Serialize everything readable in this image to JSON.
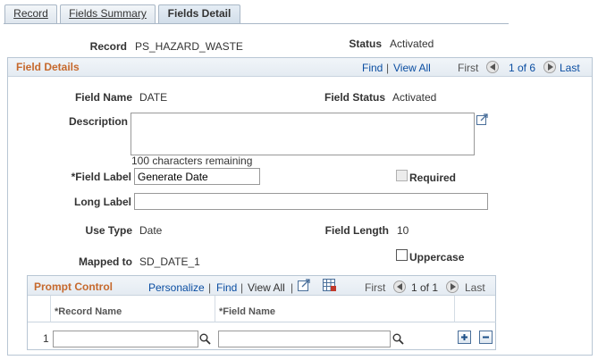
{
  "tabs": [
    {
      "label": "Record",
      "active": false
    },
    {
      "label": "Fields Summary",
      "active": false
    },
    {
      "label": "Fields Detail",
      "active": true
    }
  ],
  "header": {
    "record_label": "Record",
    "record_value": "PS_HAZARD_WASTE",
    "status_label": "Status",
    "status_value": "Activated"
  },
  "section": {
    "title": "Field Details",
    "find": "Find",
    "sep": "|",
    "view_all": "View All",
    "first": "First",
    "count": "1 of 6",
    "last": "Last"
  },
  "fields": {
    "field_name_label": "Field Name",
    "field_name_value": "DATE",
    "field_status_label": "Field Status",
    "field_status_value": "Activated",
    "description_label": "Description",
    "description_value": "",
    "chars_remaining": "100 characters remaining",
    "field_label_label": "*Field Label",
    "field_label_value": "Generate Date",
    "required_label": "Required",
    "long_label_label": "Long Label",
    "long_label_value": "",
    "use_type_label": "Use Type",
    "use_type_value": "Date",
    "field_length_label": "Field Length",
    "field_length_value": "10",
    "mapped_to_label": "Mapped to",
    "mapped_to_value": "SD_DATE_1",
    "uppercase_label": "Uppercase"
  },
  "prompt": {
    "title": "Prompt Control",
    "personalize": "Personalize",
    "sep": "|",
    "find": "Find",
    "view_all": "View All",
    "first": "First",
    "count": "1 of 1",
    "last": "Last",
    "col_record": "*Record Name",
    "col_field": "*Field Name",
    "row_num": "1",
    "record_value": "",
    "field_value": ""
  },
  "colors": {
    "section_title": "#c6692d",
    "link": "#0b4ea2",
    "border": "#b8c6d4"
  },
  "icons": [
    "expand-icon",
    "prev-circle-icon",
    "next-circle-icon",
    "zoom-icon",
    "grid-download-icon",
    "lookup-icon",
    "add-row-icon",
    "delete-row-icon"
  ]
}
